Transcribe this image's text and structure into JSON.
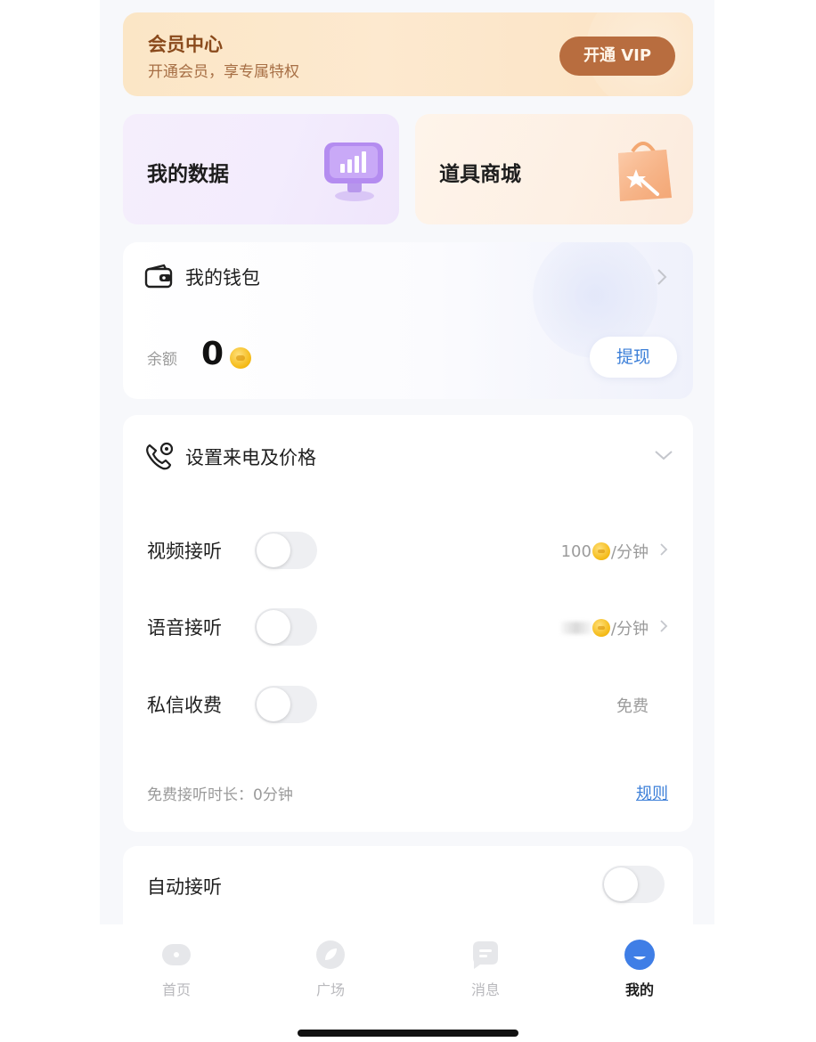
{
  "vip": {
    "title": "会员中心",
    "subtitle": "开通会员，享专属特权",
    "button": "开通 VIP"
  },
  "cards": {
    "data_label": "我的数据",
    "shop_label": "道具商城"
  },
  "wallet": {
    "title": "我的钱包",
    "balance_label": "余额",
    "balance": "0",
    "withdraw": "提现"
  },
  "call_settings": {
    "title": "设置来电及价格",
    "rows": [
      {
        "label": "视频接听",
        "enabled": false,
        "price": "100",
        "unit": "/分钟"
      },
      {
        "label": "语音接听",
        "enabled": false,
        "price": "",
        "unit": "/分钟"
      },
      {
        "label": "私信收费",
        "enabled": false,
        "price_text": "免费"
      }
    ],
    "free_duration": "免费接听时长：0分钟",
    "rules": "规则"
  },
  "auto_answer": {
    "label": "自动接听",
    "enabled": false
  },
  "tabs": [
    {
      "label": "首页",
      "icon": "home-icon"
    },
    {
      "label": "广场",
      "icon": "square-icon"
    },
    {
      "label": "消息",
      "icon": "message-icon"
    },
    {
      "label": "我的",
      "icon": "profile-icon",
      "active": true
    }
  ],
  "colors": {
    "accent_blue": "#3c7fd8",
    "vip_button": "#b86d3f",
    "coin": "#f4b914",
    "toggle_off": "#eeeff2"
  }
}
